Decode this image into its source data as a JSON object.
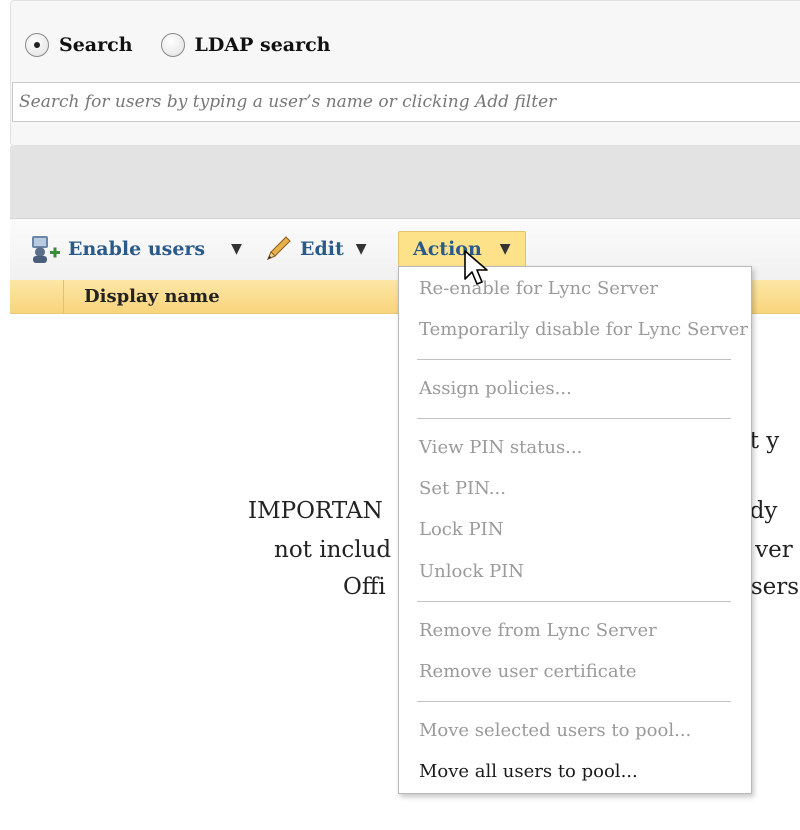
{
  "search": {
    "mode_search_label": "Search",
    "mode_ldap_label": "LDAP search",
    "placeholder": "Search for users by typing a user’s name or clicking Add filter"
  },
  "toolbar": {
    "enable_users_label": "Enable users",
    "edit_label": "Edit",
    "action_label": "Action"
  },
  "grid": {
    "column_display_name": "Display name"
  },
  "background_message": {
    "line1_left": "IMPORTAN",
    "line2_left": "not includ",
    "line3_left": "Offi",
    "line0_right": "at y",
    "line1_right": "ady",
    "line2_right": "s ver",
    "line3_right": "users"
  },
  "action_menu": {
    "items": [
      {
        "label": "Re-enable for Lync Server",
        "enabled": false
      },
      {
        "label": "Temporarily disable for Lync Server",
        "enabled": false
      },
      {
        "label": "Assign policies...",
        "enabled": false
      },
      {
        "label": "View PIN status...",
        "enabled": false
      },
      {
        "label": "Set PIN...",
        "enabled": false
      },
      {
        "label": "Lock PIN",
        "enabled": false
      },
      {
        "label": "Unlock PIN",
        "enabled": false
      },
      {
        "label": "Remove from Lync Server",
        "enabled": false
      },
      {
        "label": "Remove user certificate",
        "enabled": false
      },
      {
        "label": "Move selected users to pool...",
        "enabled": false
      },
      {
        "label": "Move all users to pool...",
        "enabled": true
      }
    ]
  },
  "colors": {
    "link_blue": "#2a5a8a",
    "header_yellow": "#f8d57c",
    "action_highlight": "#fde28a",
    "disabled_text": "#9a9a9a"
  },
  "icons": [
    "enable-users-icon",
    "pencil-icon",
    "caret-down-icon",
    "mouse-cursor-icon"
  ]
}
